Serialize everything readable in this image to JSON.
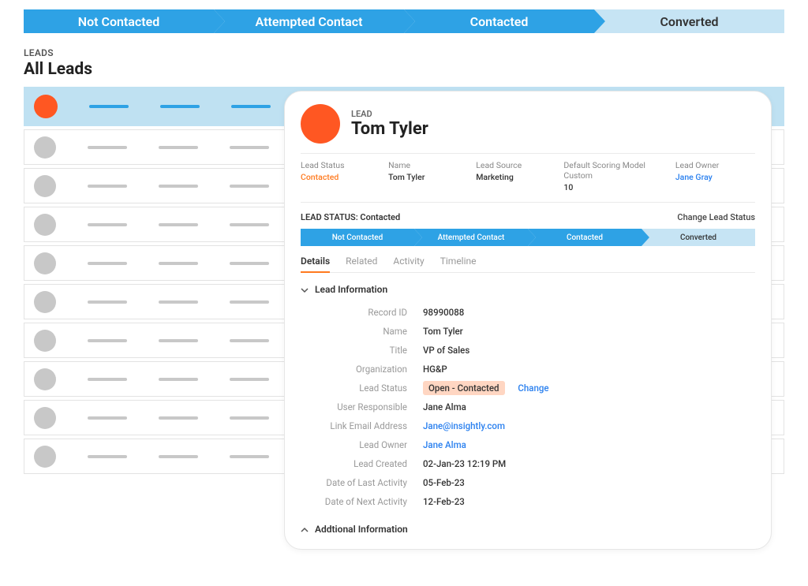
{
  "pipeline": {
    "stages": [
      "Not Contacted",
      "Attempted Contact",
      "Contacted",
      "Converted"
    ],
    "active_index": 2
  },
  "leads": {
    "section_label": "LEADS",
    "title": "All Leads"
  },
  "detail": {
    "label": "LEAD",
    "name": "Tom Tyler",
    "summary": {
      "lead_status": {
        "label": "Lead Status",
        "value": "Contacted"
      },
      "name": {
        "label": "Name",
        "value": "Tom Tyler"
      },
      "lead_source": {
        "label": "Lead Source",
        "value": "Marketing"
      },
      "scoring": {
        "label": "Default Scoring Model Custom",
        "value": "10"
      },
      "lead_owner": {
        "label": "Lead Owner",
        "value": "Jane Gray"
      }
    },
    "status_line": {
      "left": "LEAD STATUS: Contacted",
      "right": "Change Lead Status"
    },
    "mini_pipeline": {
      "stages": [
        "Not Contacted",
        "Attempted Contact",
        "Contacted",
        "Converted"
      ],
      "active_index": 2
    },
    "tabs": [
      "Details",
      "Related",
      "Activity",
      "Timeline"
    ],
    "section_header": "Lead Information",
    "info": {
      "record_id": {
        "label": "Record ID",
        "value": "98990088"
      },
      "name": {
        "label": "Name",
        "value": "Tom Tyler"
      },
      "title": {
        "label": "Title",
        "value": "VP of Sales"
      },
      "organization": {
        "label": "Organization",
        "value": "HG&P"
      },
      "lead_status": {
        "label": "Lead Status",
        "value": "Open - Contacted",
        "change": "Change"
      },
      "user_responsible": {
        "label": "User Responsible",
        "value": "Jane Alma"
      },
      "email": {
        "label": "Link Email Address",
        "value": "Jane@insightly.com"
      },
      "lead_owner": {
        "label": "Lead Owner",
        "value": "Jane Alma"
      },
      "lead_created": {
        "label": "Lead Created",
        "value": "02-Jan-23 12:19 PM"
      },
      "last_activity": {
        "label": "Date of Last Activity",
        "value": "05-Feb-23"
      },
      "next_activity": {
        "label": "Date of Next Activity",
        "value": "12-Feb-23"
      }
    },
    "additional_header": "Addtional Information"
  }
}
